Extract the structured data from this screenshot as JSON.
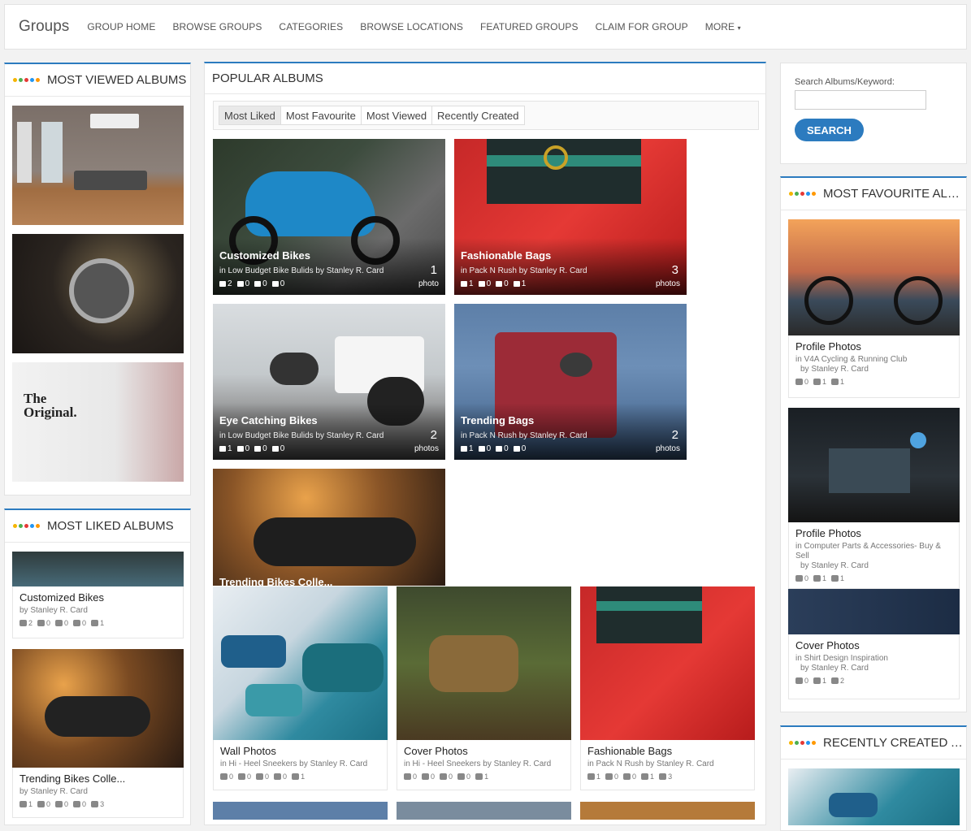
{
  "nav": {
    "brand": "Groups",
    "links": [
      "GROUP HOME",
      "BROWSE GROUPS",
      "CATEGORIES",
      "BROWSE LOCATIONS",
      "FEATURED GROUPS",
      "CLAIM FOR GROUP",
      "MORE"
    ],
    "more_caret": "▾"
  },
  "left": {
    "most_viewed_title": "MOST VIEWED ALBUMS",
    "most_liked_title": "MOST LIKED ALBUMS",
    "liked_cards": [
      {
        "title": "Customized Bikes",
        "by": "by Stanley R. Card",
        "likes": "2",
        "comments": "0",
        "views": "0",
        "favs": "0",
        "photos": "1"
      },
      {
        "title": "Trending Bikes Colle...",
        "by": "by Stanley R. Card",
        "likes": "1",
        "comments": "0",
        "views": "0",
        "favs": "0",
        "photos": "3"
      }
    ]
  },
  "center": {
    "title": "POPULAR ALBUMS",
    "tabs": [
      "Most Liked",
      "Most Favourite",
      "Most Viewed",
      "Recently Created"
    ],
    "tiles": [
      {
        "title": "Customized Bikes",
        "meta": "in Low Budget Bike Bulids   by Stanley R. Card",
        "likes": "2",
        "comments": "0",
        "views": "0",
        "favs": "0",
        "count": "1",
        "unit": "photo"
      },
      {
        "title": "Fashionable Bags",
        "meta": "in Pack N Rush   by Stanley R. Card",
        "likes": "1",
        "comments": "0",
        "views": "0",
        "favs": "1",
        "count": "3",
        "unit": "photos"
      },
      {
        "title": "Eye Catching Bikes",
        "meta": "in Low Budget Bike Bulids   by Stanley R. Card",
        "likes": "1",
        "comments": "0",
        "views": "0",
        "favs": "0",
        "count": "2",
        "unit": "photos"
      },
      {
        "title": "Trending Bags",
        "meta": "in Pack N Rush   by Stanley R. Card",
        "likes": "1",
        "comments": "0",
        "views": "0",
        "favs": "0",
        "count": "2",
        "unit": "photos"
      },
      {
        "title": "Trending Bikes Colle..."
      }
    ],
    "grid_cards": [
      {
        "title": "Wall Photos",
        "meta": "in Hi - Heel Sneekers   by Stanley R. Card",
        "likes": "0",
        "comments": "0",
        "views": "0",
        "favs": "0",
        "photos": "1"
      },
      {
        "title": "Cover Photos",
        "meta": "in Hi - Heel Sneekers   by Stanley R. Card",
        "likes": "0",
        "comments": "0",
        "views": "0",
        "favs": "0",
        "photos": "1"
      },
      {
        "title": "Fashionable Bags",
        "meta": "in Pack N Rush   by Stanley R. Card",
        "likes": "1",
        "comments": "0",
        "views": "0",
        "favs": "1",
        "photos": "3"
      }
    ]
  },
  "right": {
    "search_label": "Search Albums/Keyword:",
    "search_button": "SEARCH",
    "fav_title": "MOST FAVOURITE ALBUM",
    "recent_title": "RECENTLY CREATED ALB...",
    "fav_cards": [
      {
        "title": "Profile Photos",
        "sub": "in V4A Cycling & Running Club",
        "by": "by Stanley R. Card",
        "views": "0",
        "favs": "1",
        "photos": "1"
      },
      {
        "title": "Profile Photos",
        "sub": "in Computer Parts & Accessories- Buy & Sell",
        "by": "by Stanley R. Card",
        "views": "0",
        "favs": "1",
        "photos": "1"
      },
      {
        "title": "Cover Photos",
        "sub": "in Shirt Design Inspiration",
        "by": "by Stanley R. Card",
        "views": "0",
        "favs": "1",
        "photos": "2"
      }
    ]
  },
  "colors": {
    "accent": "#2c7bbf",
    "dot1": "#f5b400",
    "dot2": "#4caf50",
    "dot3": "#e53935",
    "dot4": "#2196f3",
    "dot5": "#ff9800"
  }
}
